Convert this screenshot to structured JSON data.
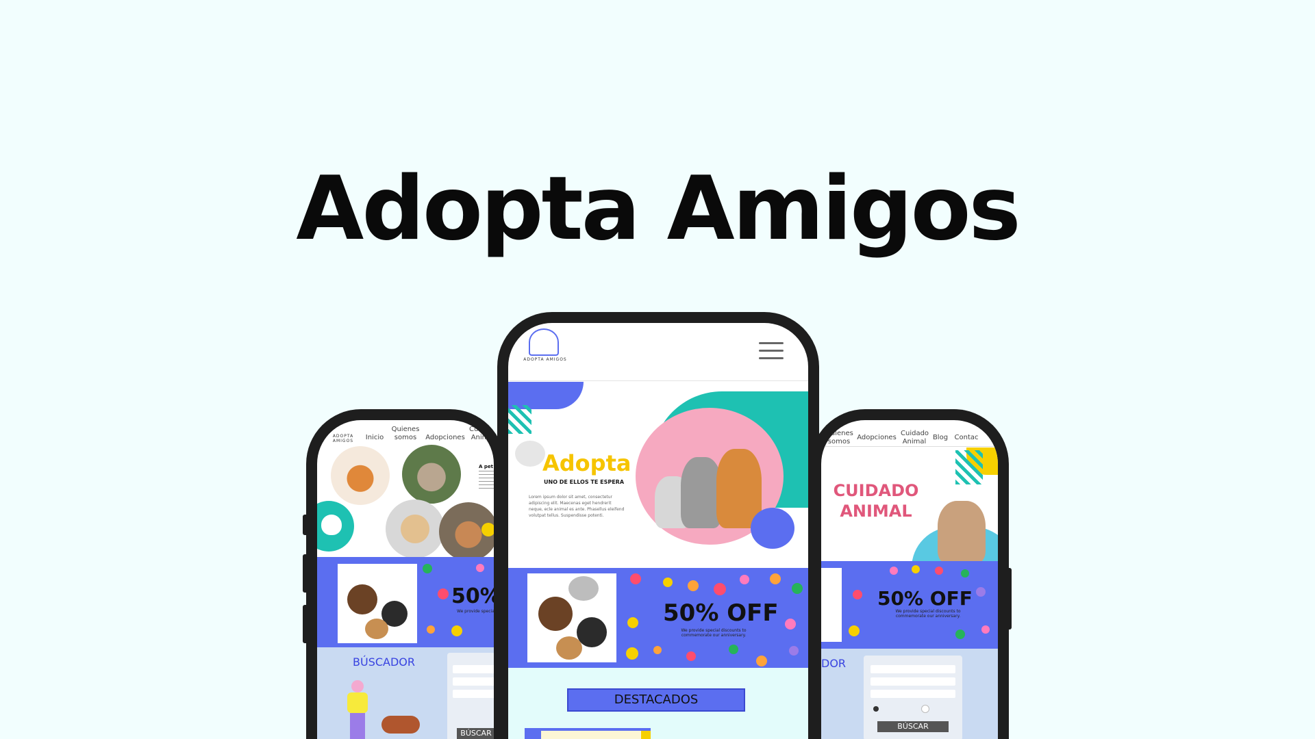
{
  "page": {
    "title": "Adopta Amigos",
    "background": "#f2fefe"
  },
  "left_phone": {
    "logo": "ADOPTA AMIGOS",
    "nav": [
      "Inicio",
      "Quienes somos",
      "Adopciones",
      "Cuidado Animal"
    ],
    "about_heading": "A pet",
    "promo": {
      "headline": "50%",
      "subtext": "We provide special discounts to commemorate our anniversary."
    },
    "search": {
      "title": "BÚSCADOR",
      "button": "BÚSCAR"
    }
  },
  "center_phone": {
    "logo": "ADOPTA AMIGOS",
    "hero": {
      "title": "Adopta",
      "subtitle": "UNO DE ELLOS TE ESPERA",
      "body": "Lorem ipsum dolor sit amet, consectetur adipiscing elit. Maecenas eget hendrerit neque, ecle animal es ante. Phasellus eleifend volutpat tellus. Suspendisse potenti."
    },
    "promo": {
      "headline": "50% OFF",
      "subtext": "We provide special discounts to commemorate our anniversary."
    },
    "featured_button": "DESTACADOS"
  },
  "right_phone": {
    "nav": [
      "Quienes somos",
      "Adopciones",
      "Cuidado Animal",
      "Blog",
      "Contac"
    ],
    "hero_title": "CUIDADO ANIMAL",
    "promo": {
      "headline": "50% OFF",
      "subtext": "We provide special discounts to commemorate our anniversary."
    },
    "search": {
      "title_fragment": "DOR",
      "button": "BÚSCAR"
    }
  },
  "colors": {
    "band_blue": "#5b6ef0",
    "teal": "#1ec1b2",
    "pink": "#f6a9c0",
    "yellow": "#f6d000",
    "search_bg": "#c9daf2",
    "destacados_bg": "#e3fcfb"
  }
}
